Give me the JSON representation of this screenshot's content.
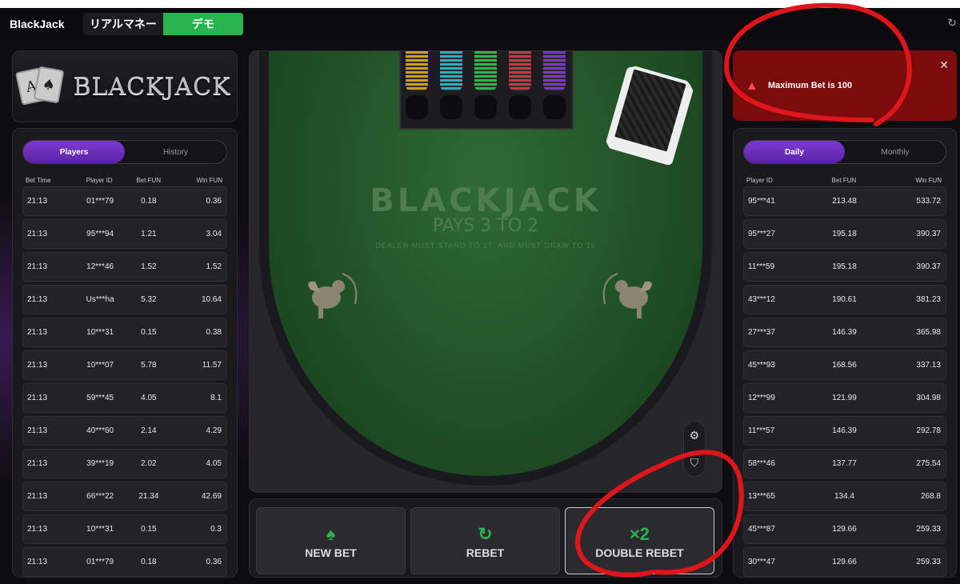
{
  "topbar": {
    "brand": "BlackJack",
    "mode_real": "リアルマネー",
    "mode_demo": "デモ"
  },
  "logo_text": "BLACKJACK",
  "players_panel": {
    "tabs": [
      "Players",
      "History"
    ],
    "headers": [
      "Bet Time",
      "Player ID",
      "Bet FUN",
      "Win FUN"
    ],
    "rows": [
      [
        "21:13",
        "01***79",
        "0.18",
        "0.36"
      ],
      [
        "21:13",
        "95***94",
        "1.21",
        "3.04"
      ],
      [
        "21:13",
        "12***46",
        "1.52",
        "1.52"
      ],
      [
        "21:13",
        "Us***ha",
        "5.32",
        "10.64"
      ],
      [
        "21:13",
        "10***31",
        "0.15",
        "0.38"
      ],
      [
        "21:13",
        "10***07",
        "5.78",
        "11.57"
      ],
      [
        "21:13",
        "59***45",
        "4.05",
        "8.1"
      ],
      [
        "21:13",
        "40***60",
        "2.14",
        "4.29"
      ],
      [
        "21:13",
        "39***19",
        "2.02",
        "4.05"
      ],
      [
        "21:13",
        "66***22",
        "21.34",
        "42.69"
      ],
      [
        "21:13",
        "10***31",
        "0.15",
        "0.3"
      ],
      [
        "21:13",
        "01***79",
        "0.18",
        "0.36"
      ]
    ]
  },
  "table": {
    "title": "BLACKJACK",
    "subtitle": "PAYS 3 TO 2",
    "rule": "DEALER MUST STAND TO 17, AND MUST DRAW TO 16"
  },
  "actions": {
    "new_bet": "NEW BET",
    "rebet": "REBET",
    "double_rebet": "DOUBLE REBET",
    "double_icon": "×2"
  },
  "alert": {
    "message": "Maximum Bet is 100"
  },
  "leaderboard": {
    "tabs": [
      "Daily",
      "Monthly"
    ],
    "headers": [
      "Player ID",
      "Bet FUN",
      "Win FUN"
    ],
    "rows": [
      [
        "95***41",
        "213.48",
        "533.72"
      ],
      [
        "95***27",
        "195.18",
        "390.37"
      ],
      [
        "11***59",
        "195.18",
        "390.37"
      ],
      [
        "43***12",
        "190.61",
        "381.23"
      ],
      [
        "27***37",
        "146.39",
        "365.98"
      ],
      [
        "45***93",
        "168.56",
        "337.13"
      ],
      [
        "12***99",
        "121.99",
        "304.98"
      ],
      [
        "11***57",
        "146.39",
        "292.78"
      ],
      [
        "58***46",
        "137.77",
        "275.54"
      ],
      [
        "13***65",
        "134.4",
        "268.8"
      ],
      [
        "45***87",
        "129.66",
        "259.33"
      ],
      [
        "30***47",
        "129.66",
        "259.33"
      ]
    ]
  },
  "colors": {
    "accent_green": "#29b34f",
    "accent_purple": "#6f2fc0",
    "alert_red": "#7a0c0c",
    "annotation_red": "#e0141b"
  }
}
